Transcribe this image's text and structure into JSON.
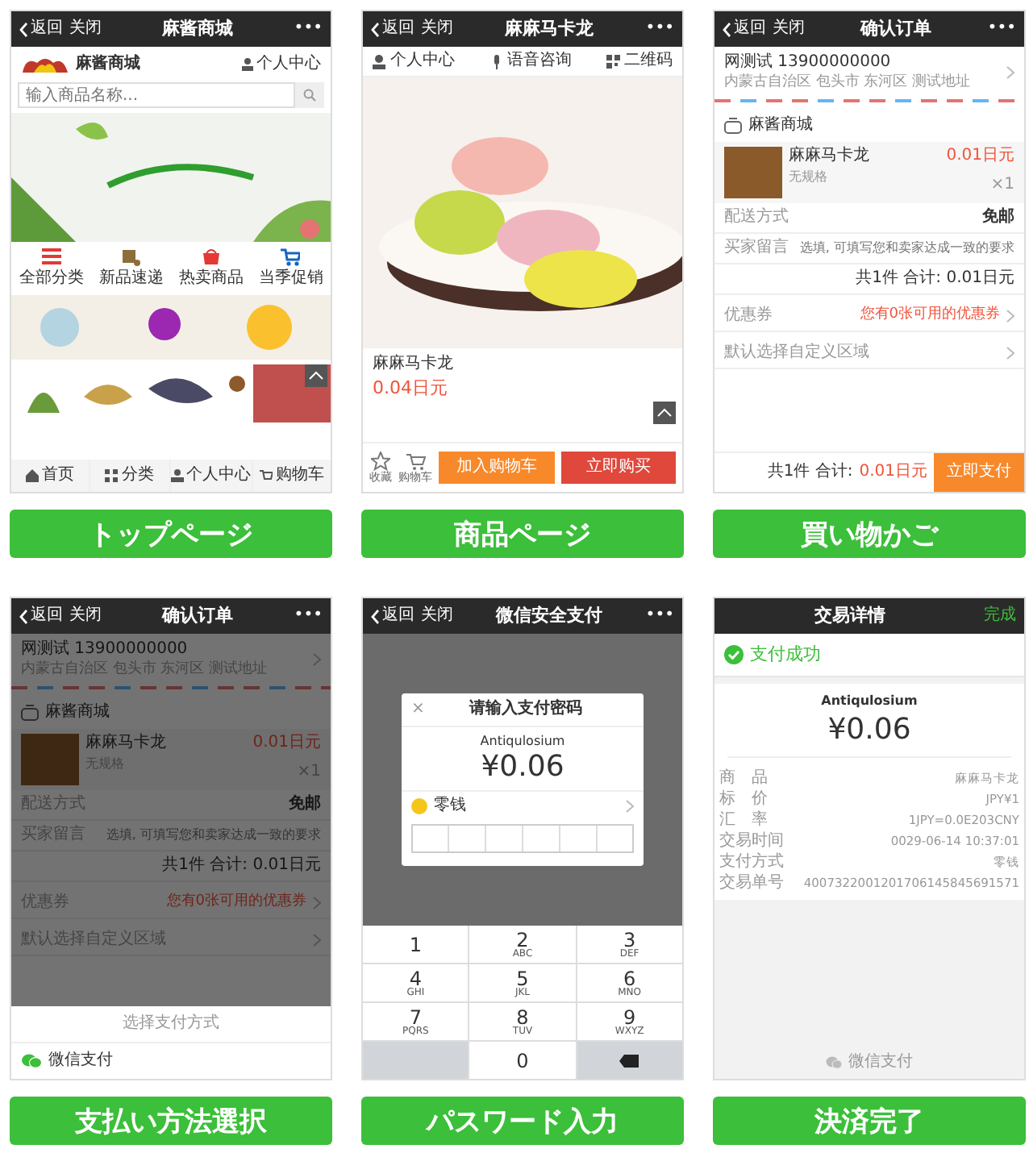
{
  "screens": [
    {
      "kind": "home",
      "caption": "トップページ",
      "nav": {
        "back": "返回",
        "close": "关闭",
        "title": "麻酱商城",
        "more": "•••"
      },
      "logo_text": "麻酱商城",
      "user_link": "个人中心",
      "search": {
        "placeholder": "输入商品名称..."
      },
      "categories": [
        "全部分类",
        "新品速递",
        "热卖商品",
        "当季促销"
      ],
      "tabs": [
        "首页",
        "分类",
        "个人中心",
        "购物车"
      ]
    },
    {
      "kind": "product",
      "caption": "商品ページ",
      "nav": {
        "back": "返回",
        "close": "关闭",
        "title": "麻麻马卡龙",
        "more": "•••"
      },
      "toolbar": [
        "个人中心",
        "语音咨询",
        "二维码"
      ],
      "product": {
        "name": "麻麻马卡龙",
        "price": "0.04日元"
      },
      "actions": {
        "favorite": "收藏",
        "cart": "购物车",
        "add_to_cart": "加入购物车",
        "buy_now": "立即购买"
      }
    },
    {
      "kind": "order",
      "caption": "買い物かご",
      "nav": {
        "back": "返回",
        "close": "关闭",
        "title": "确认订单",
        "more": "•••"
      },
      "address": {
        "contact": "网测试 13900000000",
        "line": "内蒙古自治区 包头市 东河区 测试地址"
      },
      "shop": "麻酱商城",
      "item": {
        "name": "麻麻马卡龙",
        "spec": "无规格",
        "price": "0.01日元",
        "qty": "×1"
      },
      "delivery": {
        "label": "配送方式",
        "value": "免邮"
      },
      "message": {
        "label": "买家留言",
        "placeholder": "选填, 可填写您和卖家达成一致的要求"
      },
      "total": "共1件 合计: 0.01日元",
      "coupon": {
        "label": "优惠券",
        "value": "您有0张可用的优惠券"
      },
      "region": "默认选择自定义区域",
      "footer": {
        "summary": "共1件 合计:",
        "amount": "0.01日元",
        "pay": "立即支付"
      }
    },
    {
      "kind": "order",
      "caption": "支払い方法選択",
      "nav": {
        "back": "返回",
        "close": "关闭",
        "title": "确认订单",
        "more": "•••"
      },
      "address": {
        "contact": "网测试 13900000000",
        "line": "内蒙古自治区 包头市 东河区 测试地址"
      },
      "shop": "麻酱商城",
      "item": {
        "name": "麻麻马卡龙",
        "spec": "无规格",
        "price": "0.01日元",
        "qty": "×1"
      },
      "delivery": {
        "label": "配送方式",
        "value": "免邮"
      },
      "message": {
        "label": "买家留言",
        "placeholder": "选填, 可填写您和卖家达成一致的要求"
      },
      "total": "共1件 合计: 0.01日元",
      "coupon": {
        "label": "优惠券",
        "value": "您有0张可用的优惠券"
      },
      "region": "默认选择自定义区域",
      "sheet": {
        "title": "选择支付方式",
        "options": [
          "微信支付"
        ]
      }
    },
    {
      "kind": "password",
      "caption": "パスワード入力",
      "nav": {
        "back": "返回",
        "close": "关闭",
        "title": "微信安全支付",
        "more": "•••"
      },
      "dialog": {
        "close": "×",
        "title": "请输入支付密码",
        "merchant": "Antiqulosium",
        "amount": "¥0.06",
        "method": "零钱"
      },
      "keys": [
        {
          "kind": "digit",
          "digit": "1"
        },
        {
          "kind": "digit",
          "digit": "2",
          "letters": "ABC"
        },
        {
          "kind": "digit",
          "digit": "3",
          "letters": "DEF"
        },
        {
          "kind": "digit",
          "digit": "4",
          "letters": "GHI"
        },
        {
          "kind": "digit",
          "digit": "5",
          "letters": "JKL"
        },
        {
          "kind": "digit",
          "digit": "6",
          "letters": "MNO"
        },
        {
          "kind": "digit",
          "digit": "7",
          "letters": "PQRS"
        },
        {
          "kind": "digit",
          "digit": "8",
          "letters": "TUV"
        },
        {
          "kind": "digit",
          "digit": "9",
          "letters": "WXYZ"
        },
        {
          "kind": "blank"
        },
        {
          "kind": "digit",
          "digit": "0"
        },
        {
          "kind": "delete"
        }
      ]
    },
    {
      "kind": "done",
      "caption": "決済完了",
      "nav": {
        "title": "交易详情",
        "done": "完成"
      },
      "status": "支付成功",
      "merchant": "Antiqulosium",
      "amount": "¥0.06",
      "details": [
        {
          "label": "商　品",
          "value": "麻麻马卡龙"
        },
        {
          "label": "标　价",
          "value": "JPY¥1"
        },
        {
          "label": "汇　率",
          "value": "1JPY=0.0E203CNY"
        },
        {
          "label": "交易时间",
          "value": "0029-06-14 10:37:01"
        },
        {
          "label": "支付方式",
          "value": "零钱"
        },
        {
          "label": "交易单号",
          "value": "4007322001201706145845691571"
        }
      ],
      "footer": "微信支付"
    }
  ]
}
